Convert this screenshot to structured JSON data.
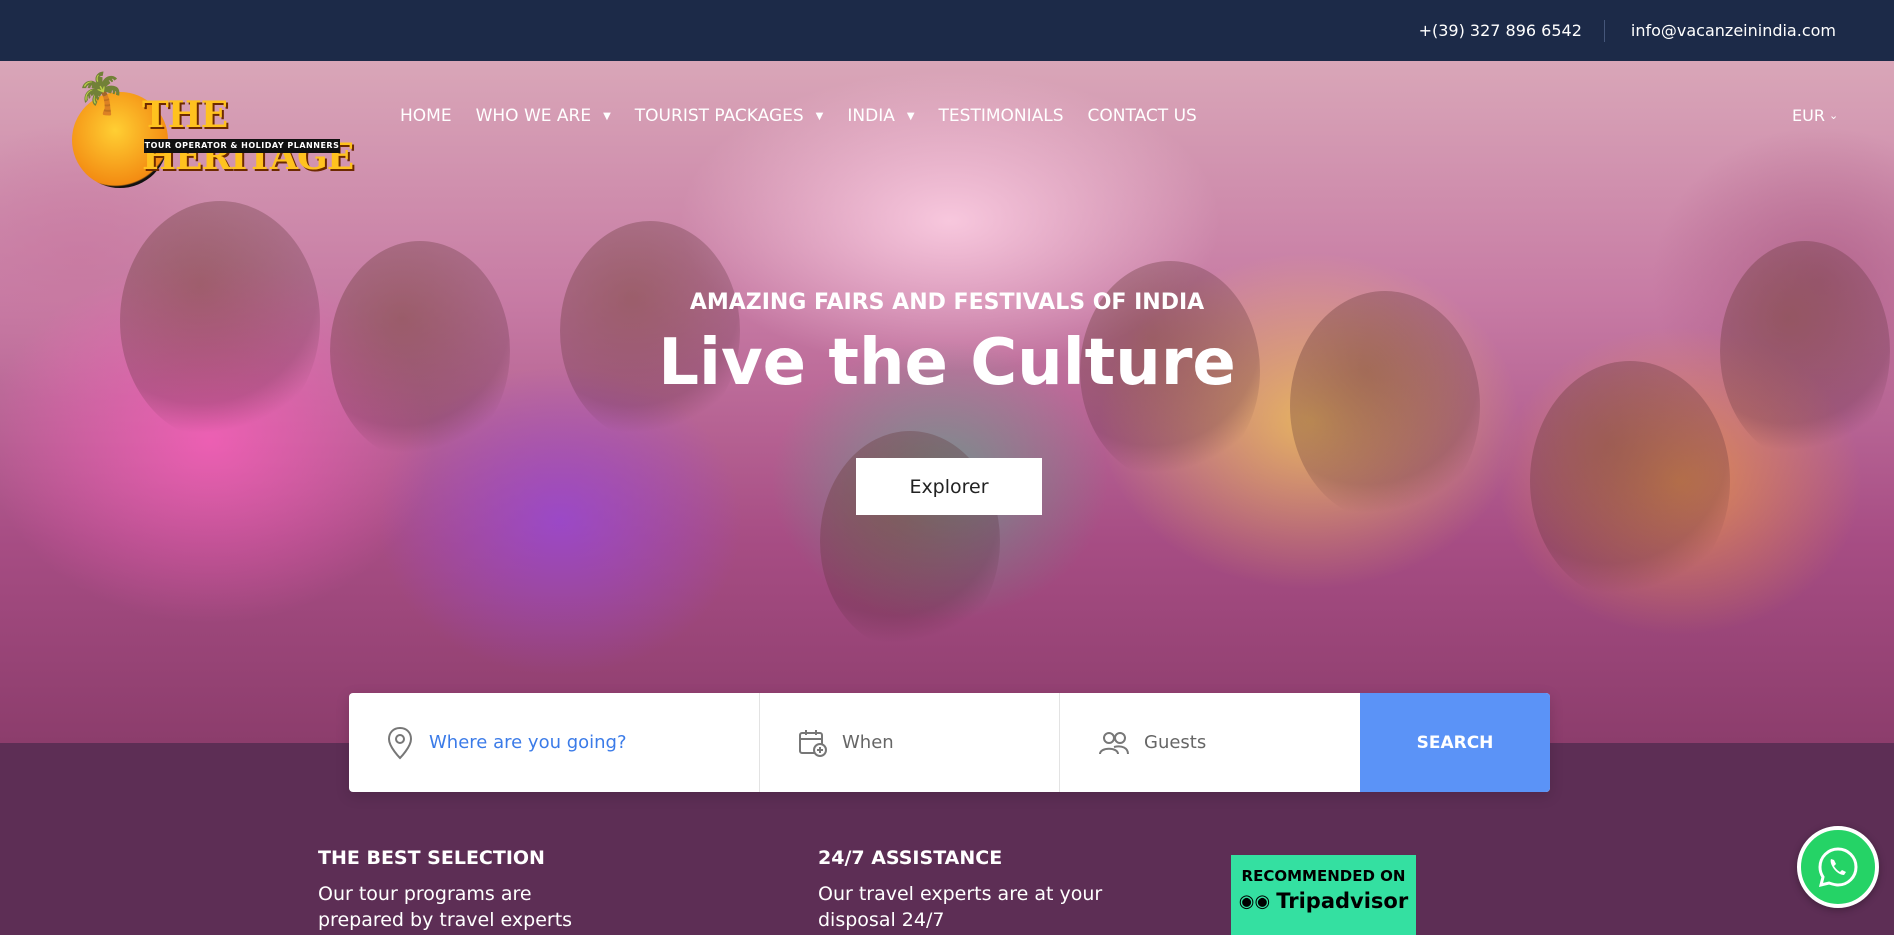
{
  "topbar": {
    "phone": "+(39) 327 896 6542",
    "email": "info@vacanzeinindia.com"
  },
  "logo": {
    "name": "THE HERITAGE",
    "tagline": "TOUR OPERATOR & HOLIDAY PLANNERS"
  },
  "nav": {
    "items": [
      {
        "label": "HOME",
        "has_dropdown": false
      },
      {
        "label": "WHO WE ARE",
        "has_dropdown": true
      },
      {
        "label": "TOURIST PACKAGES",
        "has_dropdown": true
      },
      {
        "label": "INDIA",
        "has_dropdown": true
      },
      {
        "label": "TESTIMONIALS",
        "has_dropdown": false
      },
      {
        "label": "CONTACT US",
        "has_dropdown": false
      }
    ],
    "currency": "EUR"
  },
  "hero": {
    "kicker": "AMAZING FAIRS AND FESTIVALS OF INDIA",
    "headline": "Live the Culture",
    "button": "Explorer"
  },
  "search": {
    "where_placeholder": "Where are you going?",
    "when_label": "When",
    "guests_label": "Guests",
    "button": "SEARCH"
  },
  "features": [
    {
      "title": "THE BEST SELECTION",
      "text": "Our tour programs are prepared by travel experts"
    },
    {
      "title": "24/7 ASSISTANCE",
      "text": "Our travel experts are at your disposal 24/7"
    }
  ],
  "tripadvisor": {
    "recommended": "RECOMMENDED ON",
    "brand": "Tripadvisor"
  },
  "colors": {
    "topbar": "#1c2a48",
    "section_bg": "#5d2e55",
    "search_button": "#5b93f7",
    "tripadvisor_green": "#34e0a1",
    "whatsapp_green": "#25d366"
  }
}
